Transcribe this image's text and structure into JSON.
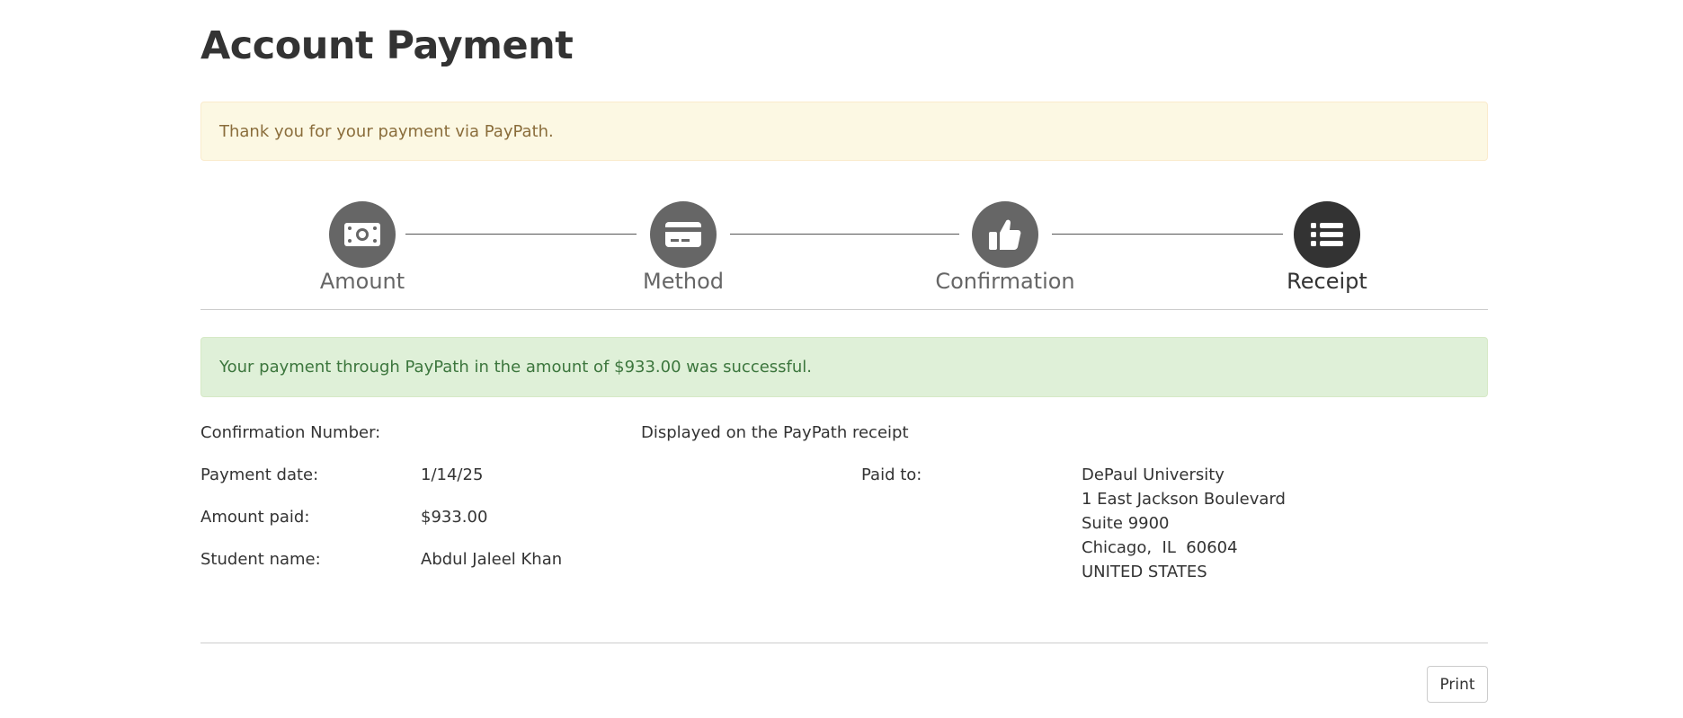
{
  "page": {
    "title": "Account Payment"
  },
  "alerts": {
    "thank_you": "Thank you for your payment via PayPath.",
    "success": "Your payment through PayPath in the amount of $933.00 was successful."
  },
  "stepper": {
    "steps": [
      {
        "label": "Amount",
        "icon": "money-bill-icon",
        "active": false
      },
      {
        "label": "Method",
        "icon": "credit-card-icon",
        "active": false
      },
      {
        "label": "Confirmation",
        "icon": "thumbs-up-icon",
        "active": false
      },
      {
        "label": "Receipt",
        "icon": "list-icon",
        "active": true
      }
    ]
  },
  "receipt": {
    "confirmation_label": "Confirmation Number:",
    "confirmation_value": "Displayed on the PayPath receipt",
    "payment_date_label": "Payment date:",
    "payment_date_value": "1/14/25",
    "amount_paid_label": "Amount paid:",
    "amount_paid_value": "$933.00",
    "student_name_label": "Student name:",
    "student_name_value": "Abdul Jaleel Khan",
    "paid_to_label": "Paid to:",
    "paid_to_lines": [
      "DePaul University",
      "1 East Jackson Boulevard",
      "Suite 9900",
      "Chicago,  IL  60604",
      "UNITED STATES"
    ]
  },
  "actions": {
    "print_label": "Print"
  },
  "colors": {
    "step_inactive": "#666666",
    "step_active": "#333333",
    "warning_bg": "#fcf8e3",
    "success_bg": "#dff0d8"
  }
}
